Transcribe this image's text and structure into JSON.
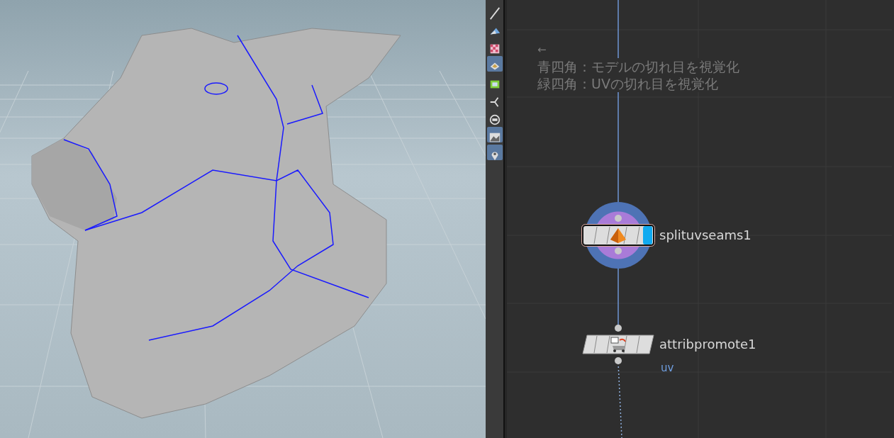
{
  "shelf_tools": [
    {
      "kind": "handle",
      "selected": false
    },
    {
      "kind": "brush",
      "selected": false
    },
    {
      "kind": "checker",
      "selected": false
    },
    {
      "kind": "layer",
      "selected": true
    },
    {
      "kind": "uvmap",
      "selected": false
    },
    {
      "kind": "axis",
      "selected": false
    },
    {
      "kind": "circle",
      "selected": false
    },
    {
      "kind": "image",
      "selected": true
    },
    {
      "kind": "pin",
      "selected": true
    }
  ],
  "sticky_note": {
    "arrow": "←",
    "lines": [
      "青四角：モデルの切れ目を視覚化",
      "緑四角：UVの切れ目を視覚化"
    ]
  },
  "nodes": [
    {
      "name": "splituvseams1",
      "kind": "pyramid",
      "selected": true,
      "display": true
    },
    {
      "name": "attribpromote1",
      "kind": "promote",
      "selected": false,
      "display": false,
      "comment": "uv"
    }
  ]
}
